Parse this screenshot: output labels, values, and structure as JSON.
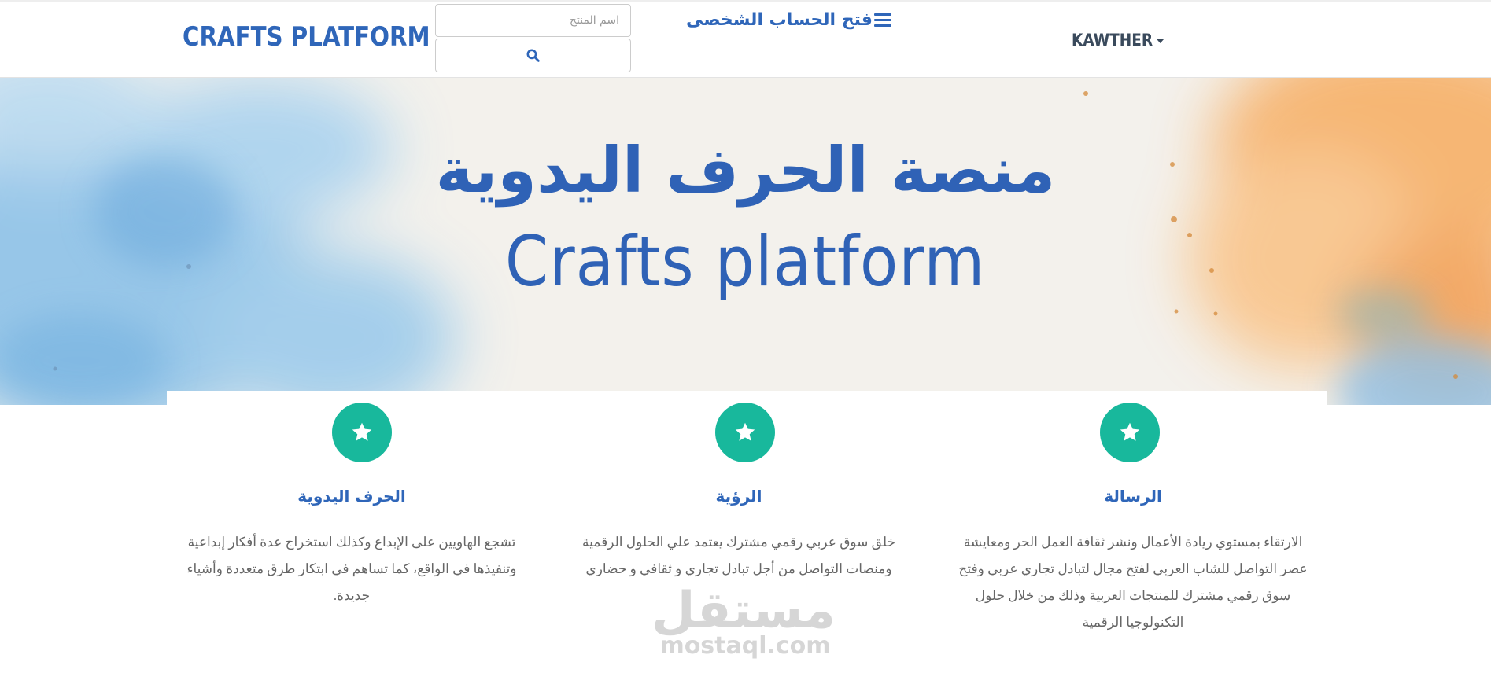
{
  "navbar": {
    "brand": "CRAFTS PLATFORM",
    "search": {
      "placeholder": "اسم المنتج",
      "value": ""
    },
    "search_button_icon": "search-icon",
    "open_profile_label": "فتح الحساب الشخصى",
    "open_profile_icon": "hamburger-menu-icon",
    "user_name": "KAWTHER",
    "user_caret_icon": "caret-down-icon"
  },
  "hero": {
    "title_ar": "منصة الحرف اليدوية",
    "title_en": "Crafts platform"
  },
  "features": [
    {
      "icon": "star-icon",
      "title": "الحرف اليدوية",
      "text": "تشجع الهاويين على الإبداع وكذلك استخراج عدة أفكار إبداعية وتنفيذها في الواقع، كما تساهم في ابتكار طرق متعددة وأشياء جديدة."
    },
    {
      "icon": "star-icon",
      "title": "الرؤية",
      "text": "خلق سوق عربي رقمي مشترك يعتمد علي الحلول الرقمية ومنصات التواصل من أجل تبادل تجاري و ثقافي و حضاري"
    },
    {
      "icon": "star-icon",
      "title": "الرسالة",
      "text": "الارتقاء بمستوي ريادة الأعمال ونشر ثقافة العمل الحر ومعايشة عصر التواصل للشاب العربي لفتح مجال لتبادل تجاري عربي وفتح سوق رقمي مشترك للمنتجات العربية وذلك من خلال حلول التكنولوجيا الرقمية"
    }
  ],
  "watermark": {
    "ar": "مستقل",
    "en": "mostaql.com"
  },
  "colors": {
    "brand_blue": "#2f66b9",
    "badge_teal": "#18b89c",
    "body_text": "#666666",
    "hero_paper": "#f3f1ec",
    "watercolor_blue": "#7fb8e2",
    "watercolor_orange": "#f4a65a"
  }
}
